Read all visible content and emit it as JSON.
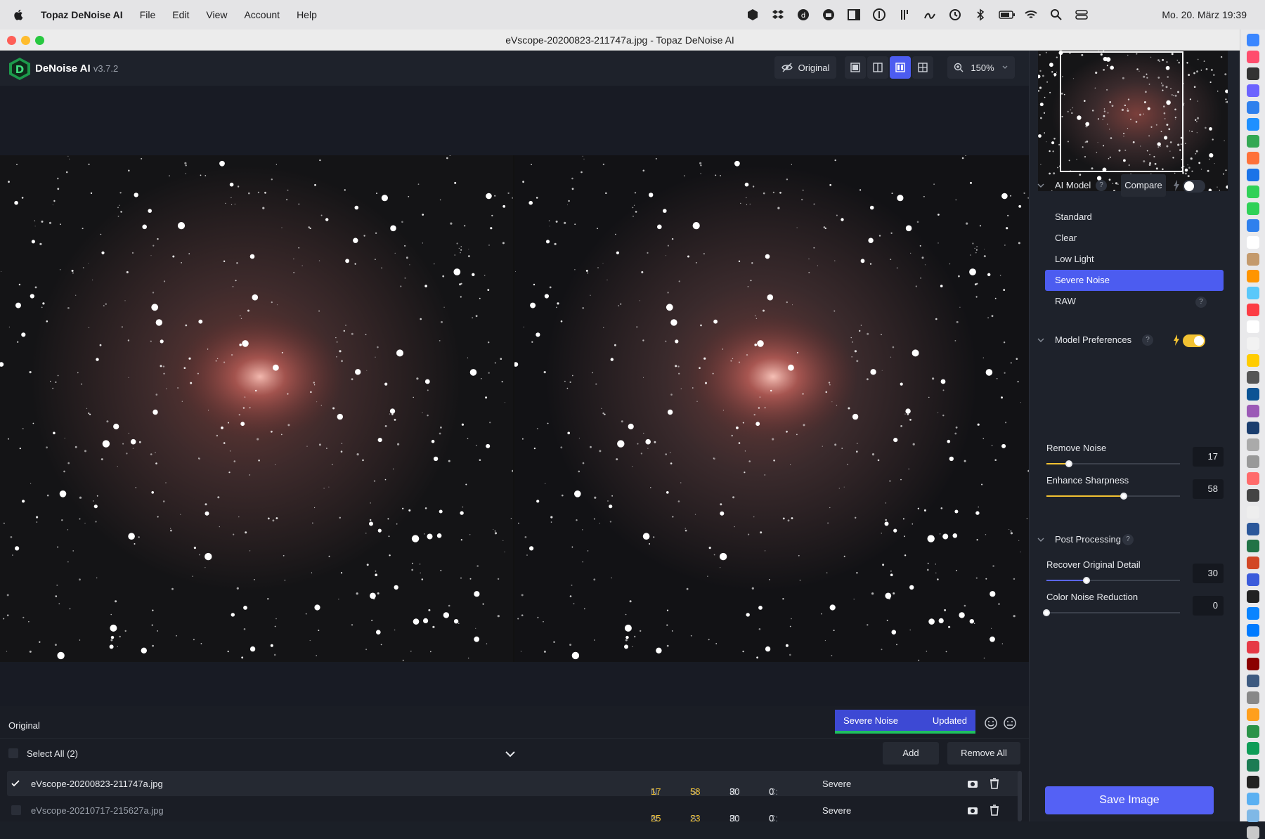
{
  "menubar": {
    "app_name": "Topaz DeNoise AI",
    "items": [
      "File",
      "Edit",
      "View",
      "Account",
      "Help"
    ],
    "clock": "Mo. 20. März  19:39"
  },
  "window": {
    "title": "eVscope-20200823-211747a.jpg - Topaz DeNoise AI"
  },
  "topbar": {
    "brand": "DeNoise AI",
    "version": "v3.7.2",
    "original_label": "Original",
    "zoom": "150%"
  },
  "ai_model": {
    "title": "AI Model",
    "compare_label": "Compare",
    "models": [
      "Standard",
      "Clear",
      "Low Light",
      "Severe Noise",
      "RAW"
    ],
    "selected": "Severe Noise"
  },
  "model_prefs": {
    "title": "Model Preferences",
    "remove_noise_label": "Remove Noise",
    "remove_noise": 17,
    "enhance_sharpness_label": "Enhance Sharpness",
    "enhance_sharpness": 58
  },
  "post_processing": {
    "title": "Post Processing",
    "recover_label": "Recover Original Detail",
    "recover": 30,
    "color_noise_label": "Color Noise Reduction",
    "color_noise": 0
  },
  "save_label": "Save Image",
  "bottom": {
    "view_label": "Original",
    "badge_model": "Severe Noise",
    "badge_status": "Updated",
    "select_all": "Select All (2)",
    "add": "Add",
    "remove_all": "Remove All"
  },
  "files": [
    {
      "name": "eVscope-20200823-211747a.jpg",
      "n": "17",
      "s": "58",
      "r": "30",
      "c": "0",
      "mode": "Severe"
    },
    {
      "name": "eVscope-20210717-215627a.jpg",
      "n": "25",
      "s": "23",
      "r": "30",
      "c": "0",
      "mode": "Severe"
    }
  ],
  "colors": {
    "accent": "#4c5cf0",
    "yellow": "#f2c232",
    "green": "#1fbf5f"
  }
}
